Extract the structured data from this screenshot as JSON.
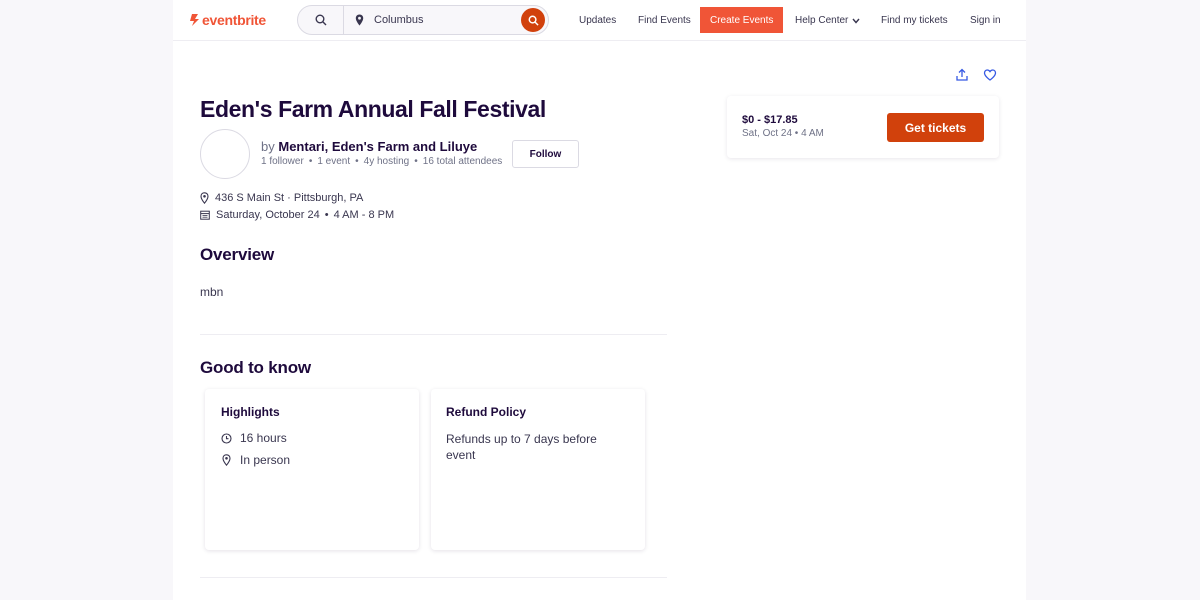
{
  "header": {
    "logo_text": "eventbrite",
    "location_value": "Columbus",
    "nav": {
      "updates": "Updates",
      "find_events": "Find Events",
      "create_events": "Create Events",
      "help_center": "Help Center",
      "find_tickets": "Find my tickets",
      "sign_in": "Sign in"
    }
  },
  "event": {
    "title": "Eden's Farm Annual Fall Festival",
    "organizer": {
      "by": "by",
      "name": "Mentari, Eden's Farm and Liluye",
      "followers": "1 follower",
      "events": "1 event",
      "hosting": "4y hosting",
      "attendees": "16 total attendees",
      "follow_label": "Follow"
    },
    "location": "436 S Main St · Pittsburgh, PA",
    "date": "Saturday, October 24",
    "time": "4 AM - 8 PM"
  },
  "overview": {
    "heading": "Overview",
    "text": "mbn"
  },
  "good_to_know": {
    "heading": "Good to know",
    "highlights": {
      "title": "Highlights",
      "duration": "16 hours",
      "mode": "In person"
    },
    "refund": {
      "title": "Refund Policy",
      "text": "Refunds up to 7 days before event"
    }
  },
  "tickets": {
    "price": "$0 - $17.85",
    "date": "Sat, Oct 24 • 4 AM",
    "button": "Get tickets"
  },
  "colors": {
    "brand": "#f05537",
    "cta": "#d1410c",
    "text": "#1e0a3c"
  }
}
